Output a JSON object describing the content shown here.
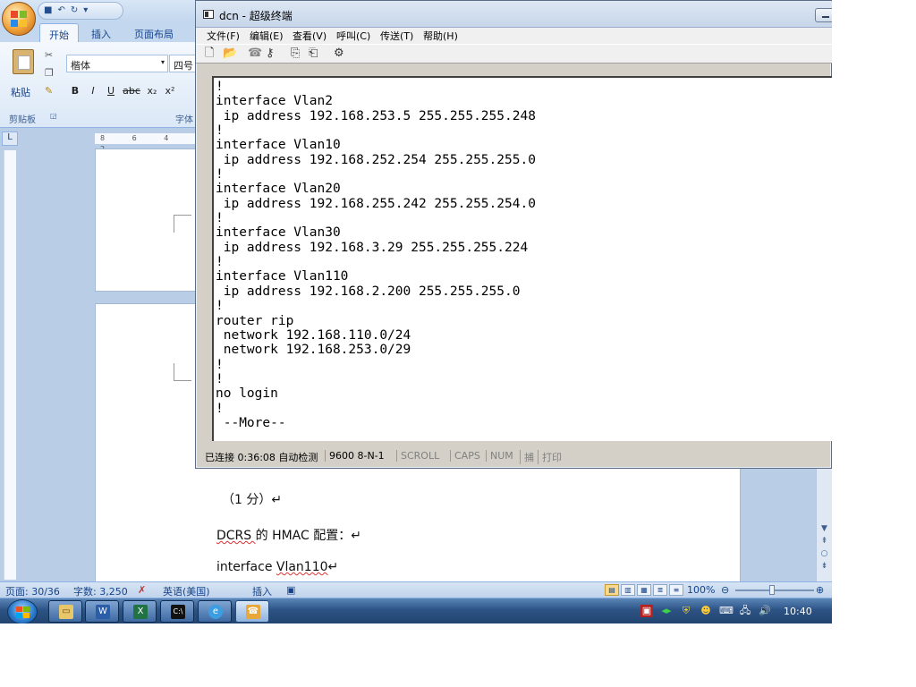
{
  "word": {
    "qat": {
      "save": "■",
      "undo": "↶",
      "redo": "↻",
      "more": "▾"
    },
    "tabs": [
      {
        "label": "开始"
      },
      {
        "label": "插入"
      },
      {
        "label": "页面布局"
      }
    ],
    "ribbon": {
      "paste_label": "粘贴",
      "font_name": "楷体",
      "font_size": "四号",
      "clipboard_group": "剪贴板",
      "font_group": "字体",
      "format_buttons": [
        "B",
        "I",
        "U",
        "abc",
        "x₂",
        "x²"
      ]
    },
    "ruler_ticks": "8 6 4 2",
    "document_lines": {
      "line1": "（1 分）↵",
      "line2_prefix": "DCRS ",
      "line2_mid": "的 HMAC 配置：↵",
      "line3_prefix": "interface ",
      "line3_mid": "Vlan110",
      "line3_suffix": "↵"
    },
    "status": {
      "page": "页面: 30/36",
      "words": "字数: 3,250",
      "language": "英语(美国)",
      "mode": "插入",
      "zoom": "100%"
    }
  },
  "terminal": {
    "title": "dcn - 超级终端",
    "menu": [
      "文件(F)",
      "编辑(E)",
      "查看(V)",
      "呼叫(C)",
      "传送(T)",
      "帮助(H)"
    ],
    "output": "!\ninterface Vlan2\n ip address 192.168.253.5 255.255.255.248\n!\ninterface Vlan10\n ip address 192.168.252.254 255.255.255.0\n!\ninterface Vlan20\n ip address 192.168.255.242 255.255.254.0\n!\ninterface Vlan30\n ip address 192.168.3.29 255.255.255.224\n!\ninterface Vlan110\n ip address 192.168.2.200 255.255.255.0\n!\nrouter rip\n network 192.168.110.0/24\n network 192.168.253.0/29\n!\n!\nno login\n!\n --More--",
    "status": {
      "connected": "已连接 0:36:08 自动检测",
      "port": "9600 8-N-1",
      "scroll": "SCROLL",
      "caps": "CAPS",
      "num": "NUM",
      "capture": "捕",
      "print": "打印"
    }
  },
  "taskbar": {
    "buttons": [
      {
        "icon": "folder-icon"
      },
      {
        "icon": "word-icon"
      },
      {
        "icon": "excel-icon"
      },
      {
        "icon": "cmd-icon"
      },
      {
        "icon": "ie-icon"
      },
      {
        "icon": "hyperterminal-icon"
      }
    ],
    "clock": "10:40"
  }
}
